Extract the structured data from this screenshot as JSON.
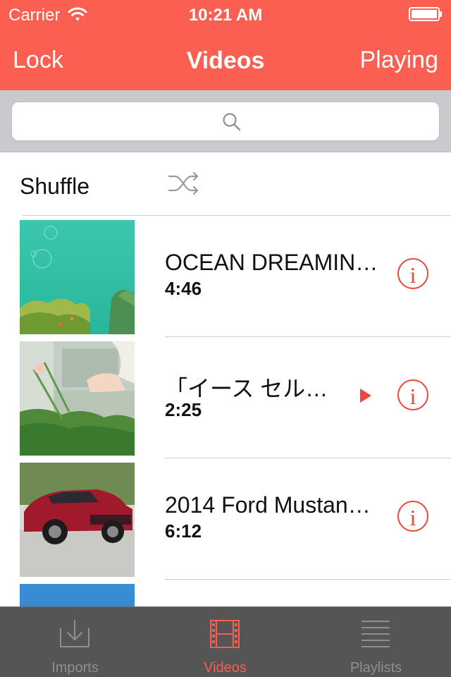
{
  "status_bar": {
    "carrier": "Carrier",
    "time": "10:21 AM",
    "wifi_icon": "wifi-icon",
    "battery_icon": "battery-icon"
  },
  "nav": {
    "left_label": "Lock",
    "title": "Videos",
    "right_label": "Playing"
  },
  "search": {
    "placeholder": "",
    "value": "",
    "icon": "search-icon"
  },
  "shuffle": {
    "label": "Shuffle",
    "icon": "shuffle-icon"
  },
  "videos": [
    {
      "title": "OCEAN DREAMIN…",
      "duration": "4:46",
      "thumbnail": "ocean-thumbnail",
      "now_playing": false
    },
    {
      "title": "「イース セル…",
      "duration": "2:25",
      "thumbnail": "anime-flower-thumbnail",
      "now_playing": true
    },
    {
      "title": "2014 Ford Mustan…",
      "duration": "6:12",
      "thumbnail": "red-car-thumbnail",
      "now_playing": false
    },
    {
      "title": "",
      "duration": "",
      "thumbnail": "blue-thumbnail",
      "now_playing": false
    }
  ],
  "info_glyph": "i",
  "tabs": [
    {
      "label": "Imports",
      "icon": "download-tray-icon",
      "active": false
    },
    {
      "label": "Videos",
      "icon": "film-strip-icon",
      "active": true
    },
    {
      "label": "Playlists",
      "icon": "list-icon",
      "active": false
    }
  ],
  "colors": {
    "accent": "#fb5f51",
    "info": "#f4443a",
    "tab_bar": "#555556",
    "search_bar": "#c9c9ce"
  }
}
